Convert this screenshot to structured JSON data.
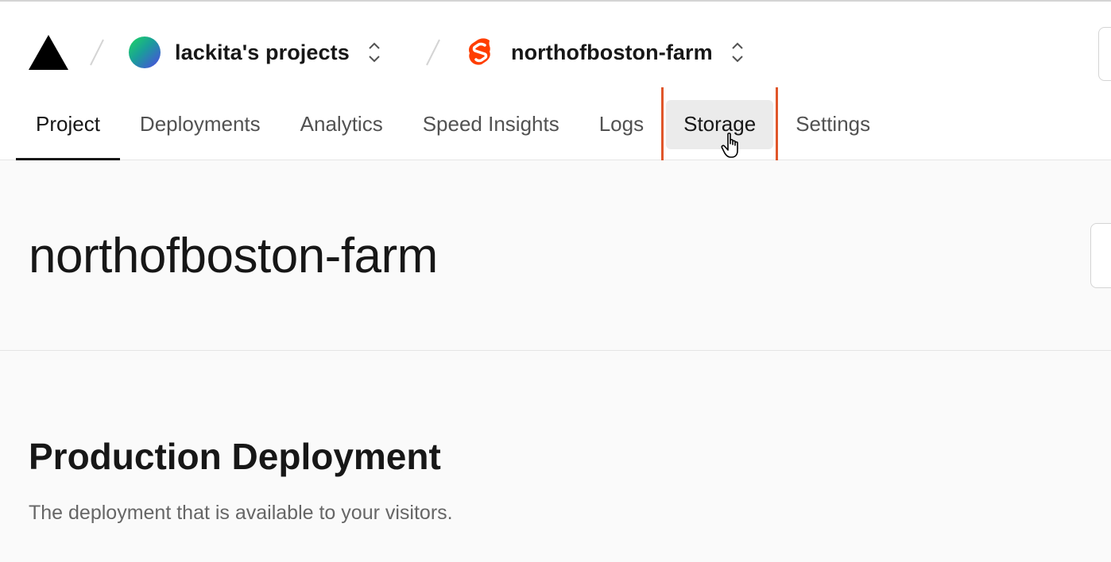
{
  "header": {
    "team": {
      "name": "lackita's projects",
      "avatar_icon": "gradient-avatar-icon"
    },
    "project": {
      "name": "northofboston-farm",
      "framework_icon": "svelte-icon",
      "icon_color": "#ff3e00"
    }
  },
  "tabs": [
    {
      "label": "Project",
      "state": "active"
    },
    {
      "label": "Deployments"
    },
    {
      "label": "Analytics"
    },
    {
      "label": "Speed Insights"
    },
    {
      "label": "Logs"
    },
    {
      "label": "Storage",
      "state": "hover"
    },
    {
      "label": "Settings"
    }
  ],
  "hero": {
    "title": "northofboston-farm"
  },
  "production": {
    "title": "Production Deployment",
    "subtitle": "The deployment that is available to your visitors."
  },
  "colors": {
    "accent_outline": "#e0562a",
    "text_primary": "#171717",
    "text_secondary": "#525252"
  }
}
